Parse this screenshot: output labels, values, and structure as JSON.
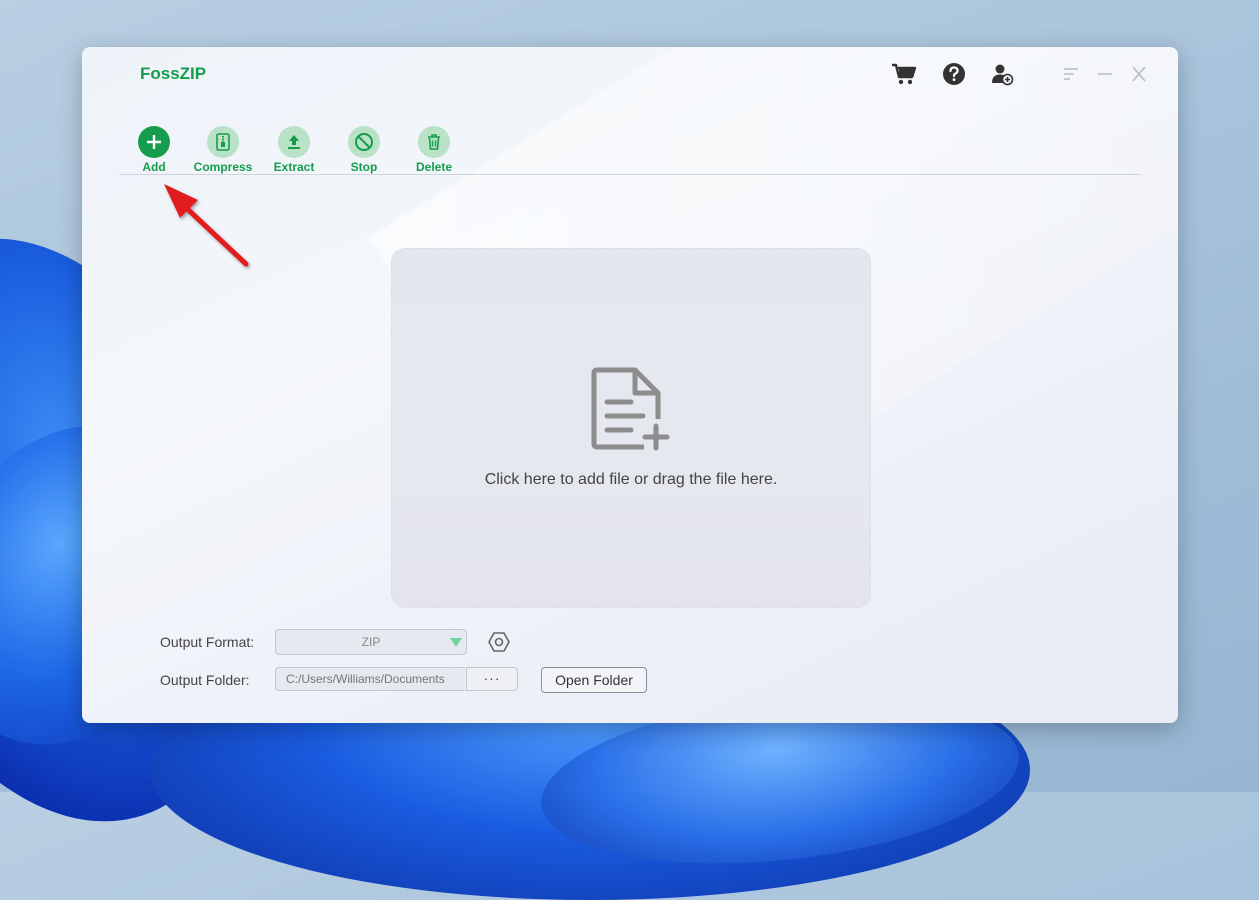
{
  "app": {
    "title": "FossZIP"
  },
  "header_icons": [
    {
      "name": "cart-icon"
    },
    {
      "name": "help-icon"
    },
    {
      "name": "user-account-icon"
    }
  ],
  "window_controls": [
    {
      "name": "menu-icon"
    },
    {
      "name": "minimize-icon"
    },
    {
      "name": "close-icon"
    }
  ],
  "toolbar": {
    "add": "Add",
    "compress": "Compress",
    "extract": "Extract",
    "stop": "Stop",
    "delete": "Delete"
  },
  "dropzone": {
    "text": "Click here to add file or drag the file here.",
    "icon": "add-file-icon"
  },
  "output": {
    "format_label": "Output Format:",
    "format_value": "ZIP",
    "folder_label": "Output Folder:",
    "folder_value": "C:/Users/Williams/Documents",
    "browse_label": "···",
    "open_folder_label": "Open Folder"
  },
  "colors": {
    "brand_green": "#169c4d",
    "light_green": "#b9e2c7",
    "annotation_red": "#e01b1b"
  }
}
